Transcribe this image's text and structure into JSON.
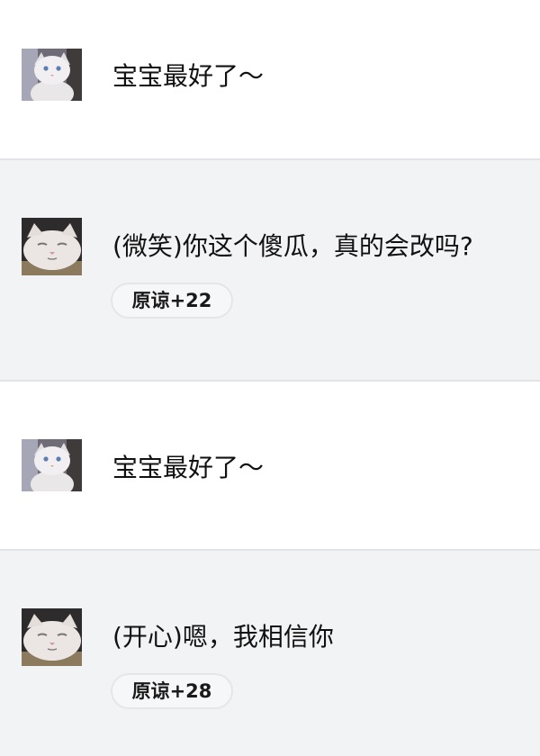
{
  "messages": [
    {
      "role": "user",
      "avatar_icon": "white-cat-icon",
      "text": "宝宝最好了～"
    },
    {
      "role": "bot",
      "avatar_icon": "smug-cat-icon",
      "text": "(微笑)你这个傻瓜，真的会改吗?",
      "badge": "原谅+22"
    },
    {
      "role": "user",
      "avatar_icon": "white-cat-icon",
      "text": "宝宝最好了～"
    },
    {
      "role": "bot",
      "avatar_icon": "smug-cat-icon",
      "text": "(开心)嗯，我相信你",
      "badge": "原谅+28"
    }
  ],
  "colors": {
    "user_bg": "#ffffff",
    "bot_bg": "#f2f3f5",
    "divider": "#e2e3e6",
    "badge_bg": "#f6f7f9",
    "badge_border": "#e5e6e8",
    "text": "#111111"
  }
}
